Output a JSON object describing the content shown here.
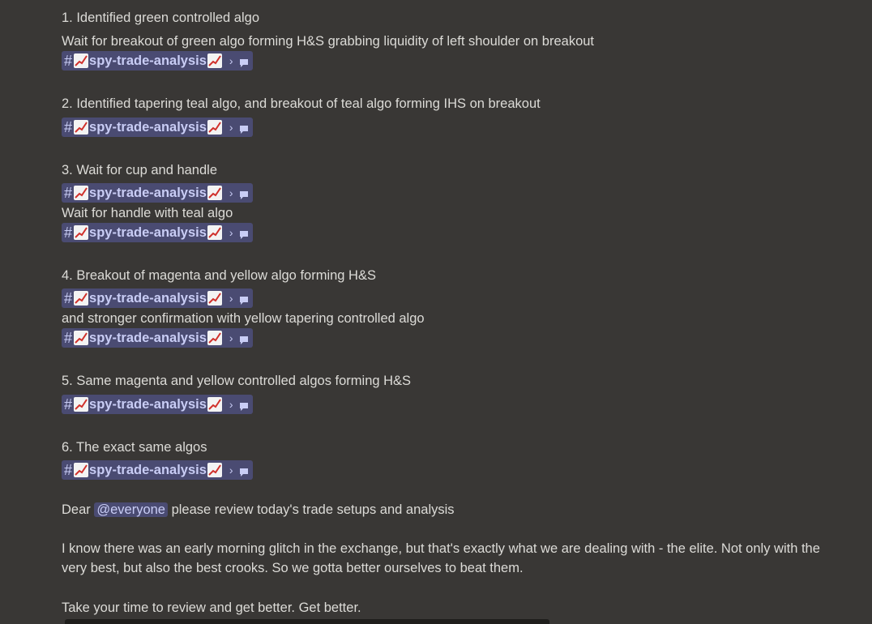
{
  "channel_chip": {
    "hash": "#",
    "name": "spy-trade-analysis",
    "separator": "›"
  },
  "sections": [
    {
      "heading": "1. Identified green controlled algo",
      "lines": [
        "Wait for breakout of green algo forming H&S grabbing liquidity of left shoulder on breakout"
      ]
    },
    {
      "heading": "2. Identified tapering teal algo, and breakout of teal algo forming IHS on breakout"
    },
    {
      "heading": "3. Wait for cup and handle",
      "lines": [
        "Wait for handle with teal algo"
      ]
    },
    {
      "heading": "4. Breakout of magenta and yellow algo forming H&S",
      "lines": [
        "and stronger confirmation with yellow tapering controlled algo"
      ]
    },
    {
      "heading": "5. Same magenta and yellow controlled algos forming H&S"
    },
    {
      "heading": "6. The exact same algos"
    }
  ],
  "closing": {
    "dear_prefix": "Dear",
    "mention": "@everyone",
    "dear_suffix": "please review today's trade setups and analysis",
    "paragraph": "I know there was an early morning glitch in the exchange, but that's exactly what we are dealing with - the elite. Not only with the very best, but also the best crooks. So we gotta better ourselves to beat them.",
    "final": "Take your time to review and get better. Get better."
  },
  "colors": {
    "background": "#393735",
    "chip_bg": "#4a4b72",
    "chip_text": "#c9cdf5",
    "text": "#dcdbd7"
  }
}
